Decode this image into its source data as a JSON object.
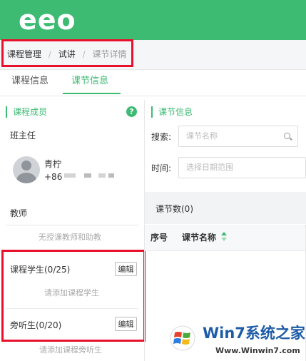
{
  "header": {
    "logo": "eeo"
  },
  "breadcrumb": {
    "items": [
      "课程管理",
      "试讲",
      "课节详情"
    ],
    "separator": "/"
  },
  "tabs": [
    {
      "label": "课程信息"
    },
    {
      "label": "课节信息"
    }
  ],
  "members": {
    "title": "课程成员",
    "help_icon": "?",
    "head_teacher_label": "班主任",
    "head_teacher": {
      "name": "青柠",
      "phone_prefix": "+86"
    },
    "teachers_label": "教师",
    "teachers_empty": "无授课教师和助教",
    "students_label": "课程学生(0/25)",
    "students_edit": "编辑",
    "students_empty": "请添加课程学生",
    "auditors_label": "旁听生(0/20)",
    "auditors_edit": "编辑",
    "auditors_empty": "请添加课程旁听生"
  },
  "lessons": {
    "title": "课节信息",
    "search_label": "搜索:",
    "search_placeholder": "课节名称",
    "time_label": "时间:",
    "time_placeholder": "选择日期范围",
    "count_label": "课节数(0)",
    "columns": [
      "序号",
      "课节名称"
    ]
  },
  "watermark": {
    "brand": "Win7系统之家",
    "url": "Www.Winwin7.com"
  },
  "colors": {
    "brand_green": "#3dbb73",
    "highlight_red": "#e8112d"
  }
}
